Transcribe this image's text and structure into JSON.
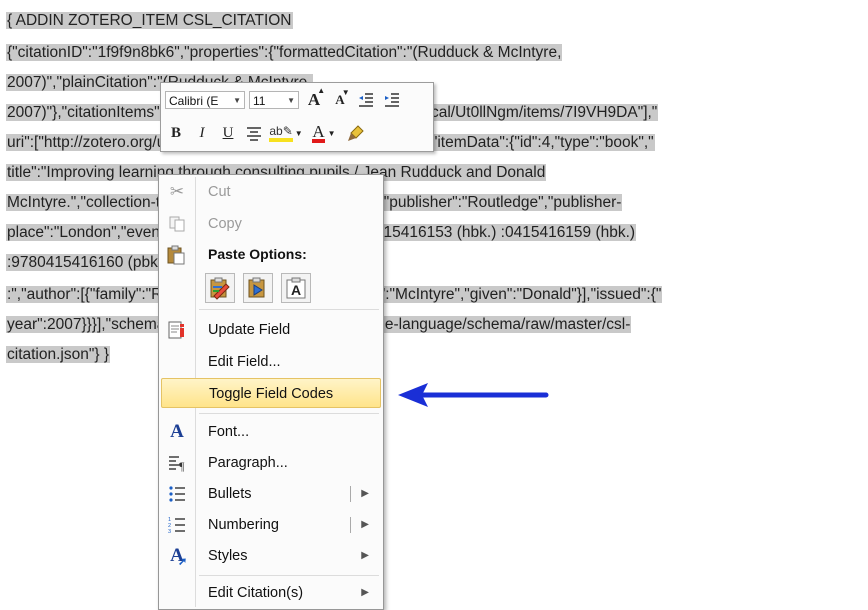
{
  "document": {
    "lines": [
      "{ ADDIN ZOTERO_ITEM CSL_CITATION",
      "{\"citationID\":\"1f9f9n8bk6\",\"properties\":{\"formattedCitation\":\"(Rudduck & McIntyre,",
      "2007)\",\"plainCitation\":\"(Rudduck & McIntyre,",
      "2007)\"},\"citationItems\":[{\"id\":4,\"uris\":[\"http://zotero.org/users/local/Ut0llNgm/items/7I9VH9DA\"],\"",
      "uri\":[\"http://zotero.org/users/local/Ut0llNgm/items/7I9VH9DA\"],\"itemData\":{\"id\":4,\"type\":\"book\",\"",
      "title\":\"Improving learning through consulting pupils / Jean Rudduck and Donald",
      "McIntyre.\",\"collection-title\":\"Improving Learning TLRP.\",\"publisher\":\"Routledge\",\"publisher-",
      "place\":\"London\",\"event-place\":\"London\",\"ISBN\":\"9780415416153 (hbk.) :0415416159 (hbk.)",
      ":9780415416160 (pbk.)",
      ":\",\"author\":[{\"family\":\"Rudduck\",\"given\":\"Jean\"},{\"family\":\"McIntyre\",\"given\":\"Donald\"}],\"issued\":{\"",
      "year\":2007}}}],\"schema\":\"https://github.com/citation-style-language/schema/raw/master/csl-",
      "citation.json\"} }"
    ]
  },
  "minibar": {
    "font_name": "Calibri (E",
    "font_size": "11",
    "grow_font": "A",
    "shrink_font": "A",
    "bold": "B",
    "italic": "I",
    "underline": "U",
    "font_color_letter": "A",
    "highlight_letter": "ab"
  },
  "menu": {
    "cut": "Cut",
    "copy": "Copy",
    "paste_options": "Paste Options:",
    "update_field": "Update Field",
    "edit_field": "Edit Field...",
    "toggle_field_codes": "Toggle Field Codes",
    "font": "Font...",
    "paragraph": "Paragraph...",
    "bullets": "Bullets",
    "numbering": "Numbering",
    "styles": "Styles",
    "edit_citation": "Edit Citation(s)"
  },
  "colors": {
    "arrow": "#1a2fd6",
    "highlight_item": "#ffe48a",
    "field_shading": "#c9c9c9"
  }
}
